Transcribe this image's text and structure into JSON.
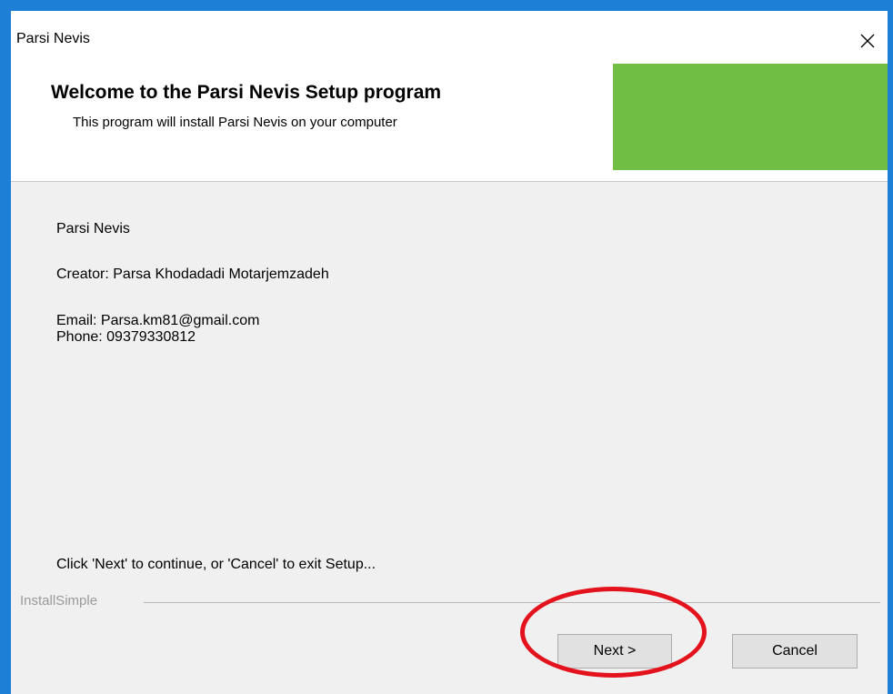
{
  "window": {
    "title": "Parsi Nevis"
  },
  "header": {
    "title": "Welcome to the Parsi Nevis Setup program",
    "subtitle": "This program will install Parsi Nevis on your computer",
    "banner_color": "#70be44"
  },
  "content": {
    "product_name": "Parsi Nevis",
    "creator": "Creator: Parsa Khodadadi Motarjemzadeh",
    "email": "Email: Parsa.km81@gmail.com",
    "phone": "Phone: 09379330812",
    "instruction": "Click 'Next' to continue, or 'Cancel' to exit Setup..."
  },
  "footer": {
    "group_label": "InstallSimple",
    "next_label": "Next >",
    "cancel_label": "Cancel"
  },
  "annotation": {
    "color": "#e3121c",
    "target": "next-button"
  }
}
